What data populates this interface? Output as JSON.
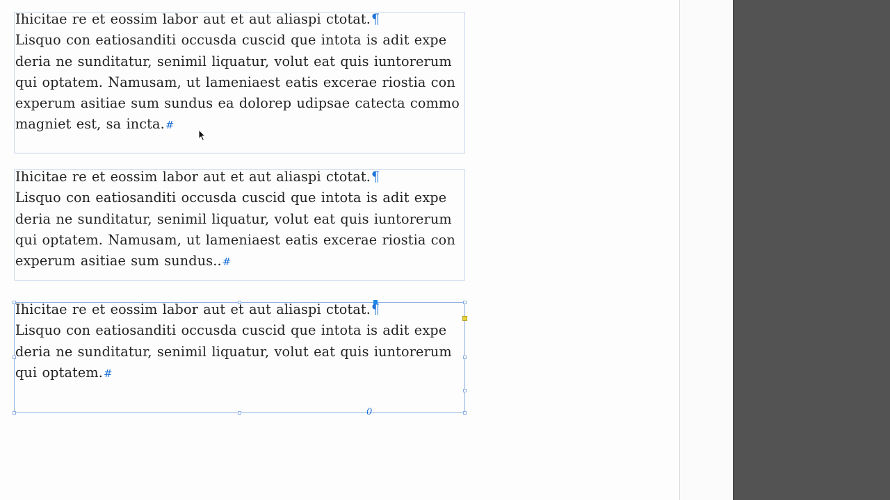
{
  "frames": [
    {
      "lines": [
        "Ihicitae re et eossim labor aut et aut aliaspi ctotat.",
        "Lisquo con eatiosanditi occusda cuscid que intota is adit expe",
        "deria ne sunditatur, senimil liquatur, volut eat quis iuntorerum",
        "qui optatem. Namusam, ut lameniaest eatis excerae riostia con",
        "experum asitiae sum sundus ea dolorep udipsae catecta commo",
        "magniet est, sa incta."
      ]
    },
    {
      "lines": [
        "Ihicitae re et eossim labor aut et aut aliaspi ctotat.",
        "Lisquo con eatiosanditi occusda cuscid que intota is adit expe",
        "deria ne sunditatur, senimil liquatur, volut eat quis iuntorerum",
        "qui optatem. Namusam, ut lameniaest eatis excerae riostia con",
        "experum asitiae sum sundus.."
      ]
    },
    {
      "lines": [
        "Ihicitae re et eossim labor aut et aut aliaspi ctotat.",
        "Lisquo con eatiosanditi occusda cuscid que intota is adit expe",
        "deria ne sunditatur, senimil liquatur, volut eat quis iuntorerum",
        "qui optatem."
      ]
    }
  ],
  "symbols": {
    "pilcrow": "¶",
    "end_of_story": "#",
    "overflow_indicator": "0"
  },
  "colors": {
    "accent": "#1e73d9",
    "frame_border": "#c9d6ec",
    "workspace": "#535353"
  }
}
